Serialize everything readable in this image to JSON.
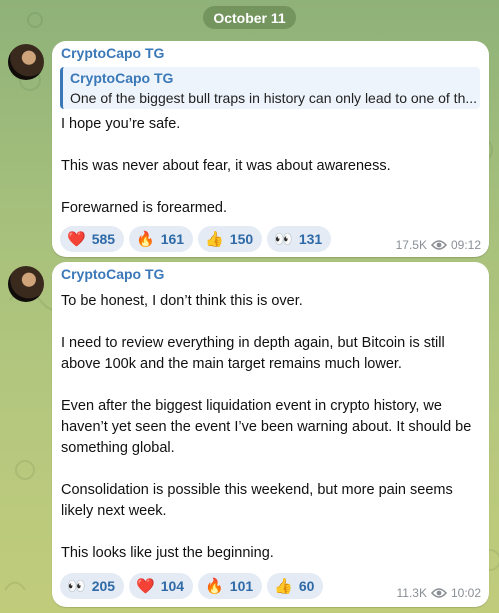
{
  "date_label": "October 11",
  "messages": [
    {
      "author": "CryptoCapo TG",
      "reply": {
        "author": "CryptoCapo TG",
        "text": "One of the biggest bull traps in history can only lead to one of th..."
      },
      "text": "I hope you’re safe.\n\nThis was never about fear, it was about awareness.\n\nForewarned is forearmed.",
      "reactions": [
        {
          "emoji": "❤️",
          "icon": "heart-icon",
          "count": "585"
        },
        {
          "emoji": "🔥",
          "icon": "fire-icon",
          "count": "161"
        },
        {
          "emoji": "👍",
          "icon": "thumbs-up-icon",
          "count": "150"
        },
        {
          "emoji": "👀",
          "icon": "eyes-icon",
          "count": "131"
        }
      ],
      "views": "17.5K",
      "time": "09:12"
    },
    {
      "author": "CryptoCapo TG",
      "text": "To be honest, I don’t think this is over.\n\nI need to review everything in depth again, but Bitcoin is still above 100k and the main target remains much lower.\n\nEven after the biggest liquidation event in crypto history, we haven’t yet seen the event I’ve been warning about. It should be something global.\n\nConsolidation is possible this weekend, but more pain seems likely next week.\n\nThis looks like just the beginning.",
      "reactions": [
        {
          "emoji": "👀",
          "icon": "eyes-icon",
          "count": "205"
        },
        {
          "emoji": "❤️",
          "icon": "heart-icon",
          "count": "104"
        },
        {
          "emoji": "🔥",
          "icon": "fire-icon",
          "count": "101"
        },
        {
          "emoji": "👍",
          "icon": "thumbs-up-icon",
          "count": "60"
        }
      ],
      "views": "11.3K",
      "time": "10:02"
    }
  ]
}
